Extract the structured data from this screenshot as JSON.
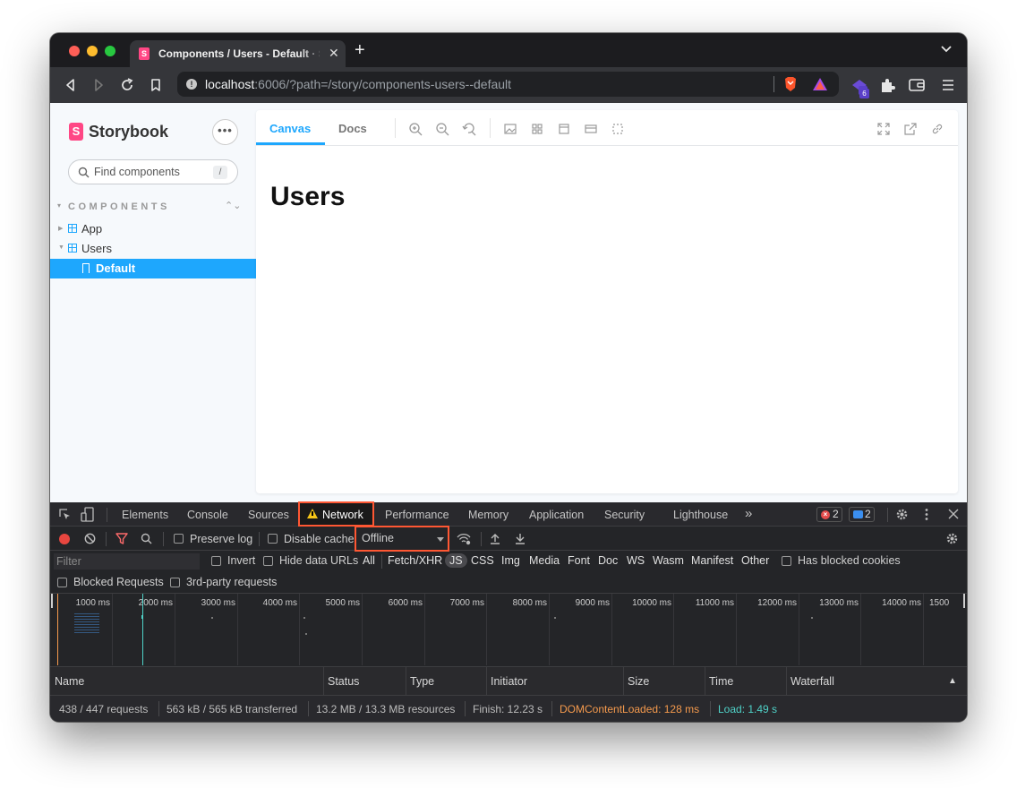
{
  "browser": {
    "tab_title": "Components / Users - Default · Storybook",
    "new_tab_symbol": "+",
    "close_symbol": "✕",
    "url_host": "localhost",
    "url_rest": ":6006/?path=/story/components-users--default",
    "extension_badge": "6"
  },
  "storybook": {
    "logo_text": "Storybook",
    "menu_symbol": "•••",
    "search_placeholder": "Find components",
    "search_shortcut": "/",
    "section_title": "COMPONENTS",
    "tree": [
      {
        "label": "App"
      },
      {
        "label": "Users"
      },
      {
        "label": "Default"
      }
    ],
    "tabs": [
      "Canvas",
      "Docs"
    ],
    "story_heading": "Users"
  },
  "devtools": {
    "tabs": [
      "Elements",
      "Console",
      "Sources",
      "Network",
      "Performance",
      "Memory",
      "Application",
      "Security",
      "Lighthouse"
    ],
    "more_symbol": "»",
    "error_count": "2",
    "message_count": "2",
    "preserve_log": "Preserve log",
    "disable_cache": "Disable cache",
    "throttling": "Offline",
    "filter_placeholder": "Filter",
    "invert": "Invert",
    "hide_data_urls": "Hide data URLs",
    "type_filters": [
      "All",
      "Fetch/XHR",
      "JS",
      "CSS",
      "Img",
      "Media",
      "Font",
      "Doc",
      "WS",
      "Wasm",
      "Manifest",
      "Other"
    ],
    "has_blocked_cookies": "Has blocked cookies",
    "blocked_requests": "Blocked Requests",
    "third_party": "3rd-party requests",
    "timeline_labels": [
      "1000 ms",
      "2000 ms",
      "3000 ms",
      "4000 ms",
      "5000 ms",
      "6000 ms",
      "7000 ms",
      "8000 ms",
      "9000 ms",
      "10000 ms",
      "11000 ms",
      "12000 ms",
      "13000 ms",
      "14000 ms",
      "1500"
    ],
    "columns": [
      "Name",
      "Status",
      "Type",
      "Initiator",
      "Size",
      "Time",
      "Waterfall"
    ],
    "sort_symbol": "▲",
    "status": {
      "requests": "438 / 447 requests",
      "transferred": "563 kB / 565 kB transferred",
      "resources": "13.2 MB / 13.3 MB resources",
      "finish": "Finish: 12.23 s",
      "dom_content_loaded": "DOMContentLoaded: 128 ms",
      "load": "Load: 1.49 s"
    }
  },
  "colors": {
    "storybook_accent": "#1ea7fd",
    "storybook_brand": "#ff4785",
    "highlight_outline": "#ff5733",
    "dcl_color": "#f59a4d",
    "load_color": "#4fd2c8"
  }
}
